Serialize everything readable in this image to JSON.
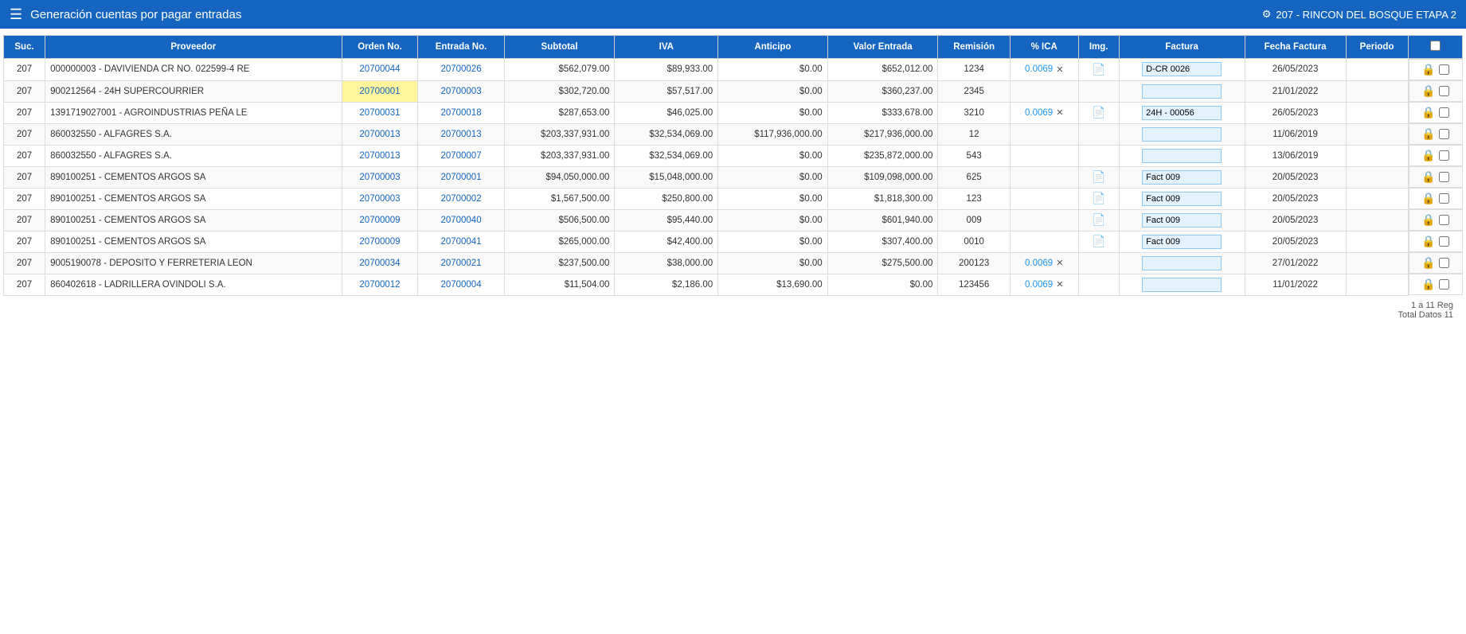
{
  "header": {
    "title": "Generación cuentas por pagar entradas",
    "menu_icon": "☰",
    "settings_icon": "⚙",
    "project": "207 - RINCON DEL BOSQUE ETAPA 2"
  },
  "table": {
    "columns": [
      "Suc.",
      "Proveedor",
      "Orden No.",
      "Entrada No.",
      "Subtotal",
      "IVA",
      "Anticipo",
      "Valor Entrada",
      "Remisión",
      "% ICA",
      "Img.",
      "Factura",
      "Fecha Factura",
      "Periodo",
      ""
    ],
    "rows": [
      {
        "suc": "207",
        "proveedor": "000000003 - DAVIVIENDA CR NO. 022599-4 RE",
        "orden": "20700044",
        "entrada": "20700026",
        "subtotal": "$562,079.00",
        "iva": "$89,933.00",
        "anticipo": "$0.00",
        "valor_entrada": "$652,012.00",
        "remision": "1234",
        "ica": "0.0069",
        "ica_x": true,
        "img": true,
        "factura": "D-CR 0026",
        "fecha_factura": "26/05/2023",
        "periodo": "",
        "lock": "green",
        "checkbox": false,
        "highlight_orden": false
      },
      {
        "suc": "207",
        "proveedor": "900212564 - 24H SUPERCOURRIER",
        "orden": "20700001",
        "entrada": "20700003",
        "subtotal": "$302,720.00",
        "iva": "$57,517.00",
        "anticipo": "$0.00",
        "valor_entrada": "$360,237.00",
        "remision": "2345",
        "ica": "",
        "ica_x": false,
        "img": false,
        "factura": "",
        "fecha_factura": "21/01/2022",
        "periodo": "",
        "lock": "red",
        "checkbox": false,
        "highlight_orden": true
      },
      {
        "suc": "207",
        "proveedor": "1391719027001 - AGROINDUSTRIAS PEÑA LE",
        "orden": "20700031",
        "entrada": "20700018",
        "subtotal": "$287,653.00",
        "iva": "$46,025.00",
        "anticipo": "$0.00",
        "valor_entrada": "$333,678.00",
        "remision": "3210",
        "ica": "0.0069",
        "ica_x": true,
        "img": true,
        "factura": "24H - 00056",
        "fecha_factura": "26/05/2023",
        "periodo": "",
        "lock": "green",
        "checkbox": false,
        "highlight_orden": false
      },
      {
        "suc": "207",
        "proveedor": "860032550 - ALFAGRES S.A.",
        "orden": "20700013",
        "entrada": "20700013",
        "subtotal": "$203,337,931.00",
        "iva": "$32,534,069.00",
        "anticipo": "$117,936,000.00",
        "valor_entrada": "$217,936,000.00",
        "remision": "12",
        "ica": "",
        "ica_x": false,
        "img": false,
        "factura": "",
        "fecha_factura": "11/06/2019",
        "periodo": "",
        "lock": "green",
        "checkbox": false,
        "highlight_orden": false
      },
      {
        "suc": "207",
        "proveedor": "860032550 - ALFAGRES S.A.",
        "orden": "20700013",
        "entrada": "20700007",
        "subtotal": "$203,337,931.00",
        "iva": "$32,534,069.00",
        "anticipo": "$0.00",
        "valor_entrada": "$235,872,000.00",
        "remision": "543",
        "ica": "",
        "ica_x": false,
        "img": false,
        "factura": "",
        "fecha_factura": "13/06/2019",
        "periodo": "",
        "lock": "green",
        "checkbox": false,
        "highlight_orden": false
      },
      {
        "suc": "207",
        "proveedor": "890100251 - CEMENTOS ARGOS SA",
        "orden": "20700003",
        "entrada": "20700001",
        "subtotal": "$94,050,000.00",
        "iva": "$15,048,000.00",
        "anticipo": "$0.00",
        "valor_entrada": "$109,098,000.00",
        "remision": "625",
        "ica": "",
        "ica_x": false,
        "img": true,
        "factura": "Fact 009",
        "fecha_factura": "20/05/2023",
        "periodo": "",
        "lock": "green",
        "checkbox": false,
        "highlight_orden": false
      },
      {
        "suc": "207",
        "proveedor": "890100251 - CEMENTOS ARGOS SA",
        "orden": "20700003",
        "entrada": "20700002",
        "subtotal": "$1,567,500.00",
        "iva": "$250,800.00",
        "anticipo": "$0.00",
        "valor_entrada": "$1,818,300.00",
        "remision": "123",
        "ica": "",
        "ica_x": false,
        "img": true,
        "factura": "Fact 009",
        "fecha_factura": "20/05/2023",
        "periodo": "",
        "lock": "green",
        "checkbox": false,
        "highlight_orden": false
      },
      {
        "suc": "207",
        "proveedor": "890100251 - CEMENTOS ARGOS SA",
        "orden": "20700009",
        "entrada": "20700040",
        "subtotal": "$506,500.00",
        "iva": "$95,440.00",
        "anticipo": "$0.00",
        "valor_entrada": "$601,940.00",
        "remision": "009",
        "ica": "",
        "ica_x": false,
        "img": true,
        "factura": "Fact 009",
        "fecha_factura": "20/05/2023",
        "periodo": "",
        "lock": "green",
        "checkbox": false,
        "highlight_orden": false
      },
      {
        "suc": "207",
        "proveedor": "890100251 - CEMENTOS ARGOS SA",
        "orden": "20700009",
        "entrada": "20700041",
        "subtotal": "$265,000.00",
        "iva": "$42,400.00",
        "anticipo": "$0.00",
        "valor_entrada": "$307,400.00",
        "remision": "0010",
        "ica": "",
        "ica_x": false,
        "img": true,
        "factura": "Fact 009",
        "fecha_factura": "20/05/2023",
        "periodo": "",
        "lock": "green",
        "checkbox": false,
        "highlight_orden": false
      },
      {
        "suc": "207",
        "proveedor": "9005190078 - DEPOSITO Y FERRETERIA LEON",
        "orden": "20700034",
        "entrada": "20700021",
        "subtotal": "$237,500.00",
        "iva": "$38,000.00",
        "anticipo": "$0.00",
        "valor_entrada": "$275,500.00",
        "remision": "200123",
        "ica": "0.0069",
        "ica_x": true,
        "img": false,
        "factura": "",
        "fecha_factura": "27/01/2022",
        "periodo": "",
        "lock": "red",
        "checkbox": false,
        "highlight_orden": false
      },
      {
        "suc": "207",
        "proveedor": "860402618 - LADRILLERA OVINDOLI S.A.",
        "orden": "20700012",
        "entrada": "20700004",
        "subtotal": "$11,504.00",
        "iva": "$2,186.00",
        "anticipo": "$13,690.00",
        "valor_entrada": "$0.00",
        "remision": "123456",
        "ica": "0.0069",
        "ica_x": true,
        "img": false,
        "factura": "",
        "fecha_factura": "11/01/2022",
        "periodo": "",
        "lock": "red",
        "checkbox": false,
        "highlight_orden": false
      }
    ],
    "pagination": {
      "range": "1 a 11 Reg",
      "total": "Total Datos 11"
    }
  }
}
